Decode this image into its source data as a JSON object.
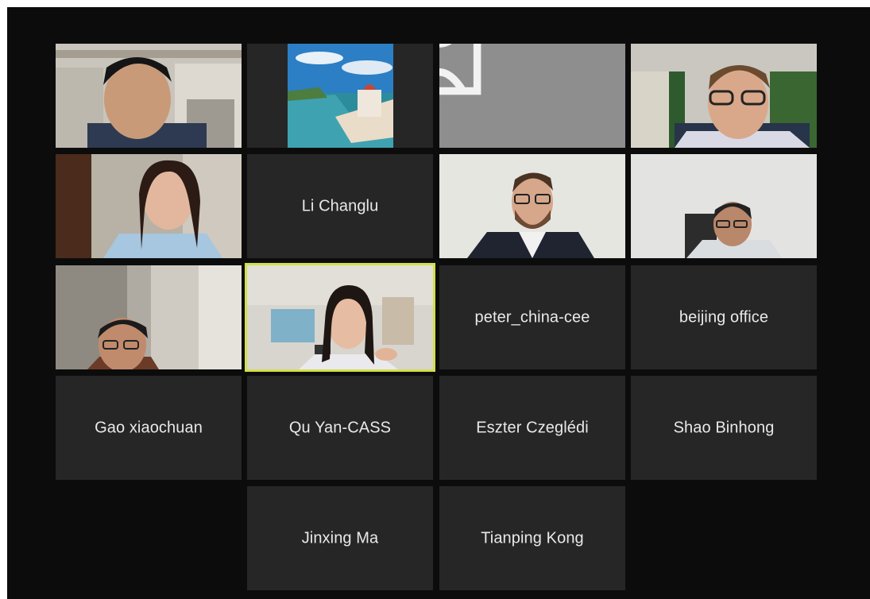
{
  "meeting": {
    "participants": [
      {
        "id": "p1",
        "display": "video",
        "name": ""
      },
      {
        "id": "p2",
        "display": "profile-photo",
        "name": ""
      },
      {
        "id": "p3",
        "display": "avatar",
        "name": "",
        "icon": "user-avatar-icon"
      },
      {
        "id": "p4",
        "display": "video",
        "name": ""
      },
      {
        "id": "p5",
        "display": "video",
        "name": ""
      },
      {
        "id": "p6",
        "display": "name",
        "name": "Li Changlu"
      },
      {
        "id": "p7",
        "display": "video",
        "name": ""
      },
      {
        "id": "p8",
        "display": "video",
        "name": ""
      },
      {
        "id": "p9",
        "display": "video",
        "name": ""
      },
      {
        "id": "p10",
        "display": "video",
        "name": "",
        "active_speaker": true
      },
      {
        "id": "p11",
        "display": "name",
        "name": "peter_china-cee"
      },
      {
        "id": "p12",
        "display": "name",
        "name": "beijing office"
      },
      {
        "id": "p13",
        "display": "name",
        "name": "Gao xiaochuan"
      },
      {
        "id": "p14",
        "display": "name",
        "name": "Qu Yan-CASS"
      },
      {
        "id": "p15",
        "display": "name",
        "name": "Eszter Czeglédi"
      },
      {
        "id": "p16",
        "display": "name",
        "name": "Shao Binhong"
      },
      {
        "id": "p17",
        "display": "name",
        "name": "Jinxing Ma"
      },
      {
        "id": "p18",
        "display": "name",
        "name": "Tianping Kong"
      }
    ]
  },
  "colors": {
    "stage_background": "#0c0c0c",
    "tile_background": "#262626",
    "active_speaker_border": "#d2e04a",
    "name_text": "#e9e9e9"
  }
}
